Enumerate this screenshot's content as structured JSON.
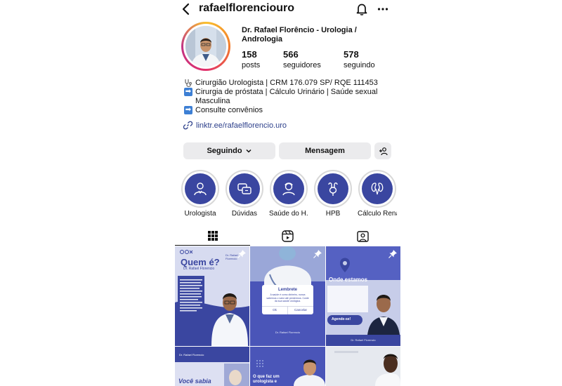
{
  "header": {
    "username": "rafaelflorenciouro"
  },
  "profile": {
    "display_name": "Dr. Rafael Florêncio - Urologia / Andrologia",
    "stats": [
      {
        "value": "158",
        "label": "posts"
      },
      {
        "value": "566",
        "label": "seguidores"
      },
      {
        "value": "578",
        "label": "seguindo"
      }
    ],
    "bio": {
      "line1": "Cirurgião Urologista | CRM 176.079 SP/ RQE 111453",
      "line2": "Cirurgia de próstata | Cálculo Urinário | Saúde sexual Masculina",
      "line3": "Consulte convênios",
      "arrow_glyph": "➡"
    },
    "link": "linktr.ee/rafaelflorencio.uro"
  },
  "actions": {
    "following_label": "Seguindo",
    "message_label": "Mensagem"
  },
  "highlights": [
    {
      "label": "Urologista",
      "icon": "doctor-icon"
    },
    {
      "label": "Dúvidas",
      "icon": "chat-icon"
    },
    {
      "label": "Saúde do H...",
      "icon": "man-icon"
    },
    {
      "label": "HPB",
      "icon": "prostate-icon"
    },
    {
      "label": "Cálculo Renal",
      "icon": "kidney-icon"
    }
  ],
  "tabs": [
    {
      "name": "grid",
      "icon": "grid-icon",
      "active": true
    },
    {
      "name": "reels",
      "icon": "reels-icon",
      "active": false
    },
    {
      "name": "tagged",
      "icon": "tagged-icon",
      "active": false
    }
  ],
  "posts": {
    "p1": {
      "title": "Quem é?",
      "subtitle": "Dr. Rafael Florencio",
      "logo": "Dr. Rafael Florencio"
    },
    "p2": {
      "dialog_title": "Lembrete",
      "dialog_text": "A saúde é como dinheiro, nunca sabemos o valor até perdermos. Cuide da sua saúde urológica.",
      "ok": "Ok",
      "cancel": "Cancelar",
      "footer": "Dr. Rafael Florencio"
    },
    "p3": {
      "title": "Onde estamos",
      "cta": "Agende-se!",
      "footer": "Dr. Rafael Florencio"
    },
    "p4": {
      "logo": "Dr. Rafael Florencio",
      "text": "Você sabia"
    },
    "p5": {
      "text": "O que faz um urologista e"
    }
  },
  "colors": {
    "brand_navy": "#3a46a0",
    "post_blue": "#4a55b8",
    "post_light": "#d9dcf2",
    "link": "#2c3f8a"
  }
}
